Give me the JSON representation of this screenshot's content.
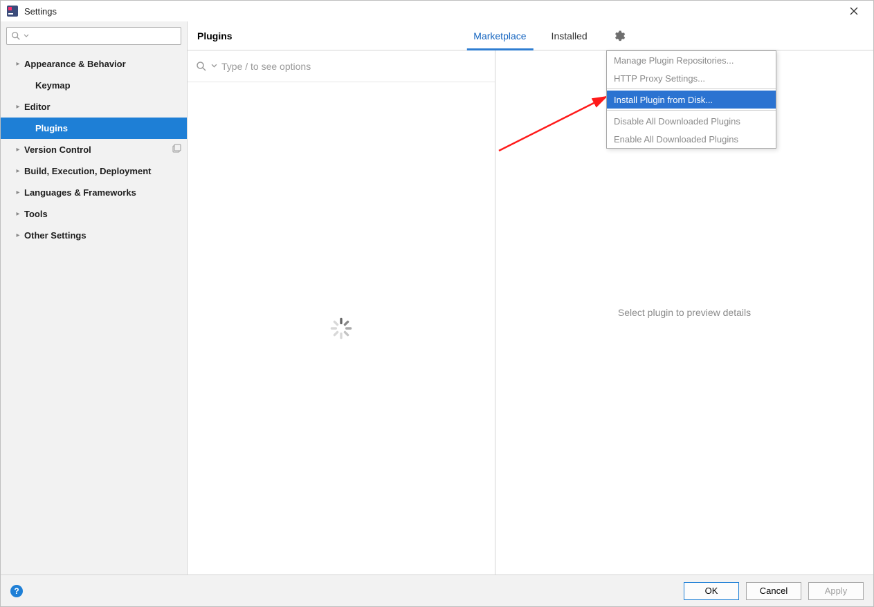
{
  "window": {
    "title": "Settings"
  },
  "sidebar": {
    "search_placeholder": "",
    "items": [
      {
        "label": "Appearance & Behavior",
        "expandable": true
      },
      {
        "label": "Keymap",
        "expandable": false
      },
      {
        "label": "Editor",
        "expandable": true
      },
      {
        "label": "Plugins",
        "expandable": false,
        "selected": true
      },
      {
        "label": "Version Control",
        "expandable": true,
        "has_copy_icon": true
      },
      {
        "label": "Build, Execution, Deployment",
        "expandable": true
      },
      {
        "label": "Languages & Frameworks",
        "expandable": true
      },
      {
        "label": "Tools",
        "expandable": true
      },
      {
        "label": "Other Settings",
        "expandable": true
      }
    ]
  },
  "main": {
    "section_title": "Plugins",
    "tabs": [
      {
        "label": "Marketplace",
        "active": true
      },
      {
        "label": "Installed",
        "active": false
      }
    ],
    "search_placeholder": "Type / to see options",
    "detail_placeholder": "Select plugin to preview details"
  },
  "gear_menu": {
    "items": [
      {
        "label": "Manage Plugin Repositories...",
        "highlight": false
      },
      {
        "label": "HTTP Proxy Settings...",
        "highlight": false
      },
      {
        "sep": true
      },
      {
        "label": "Install Plugin from Disk...",
        "highlight": true
      },
      {
        "sep": true
      },
      {
        "label": "Disable All Downloaded Plugins",
        "highlight": false
      },
      {
        "label": "Enable All Downloaded Plugins",
        "highlight": false
      }
    ]
  },
  "footer": {
    "ok": "OK",
    "cancel": "Cancel",
    "apply": "Apply"
  }
}
